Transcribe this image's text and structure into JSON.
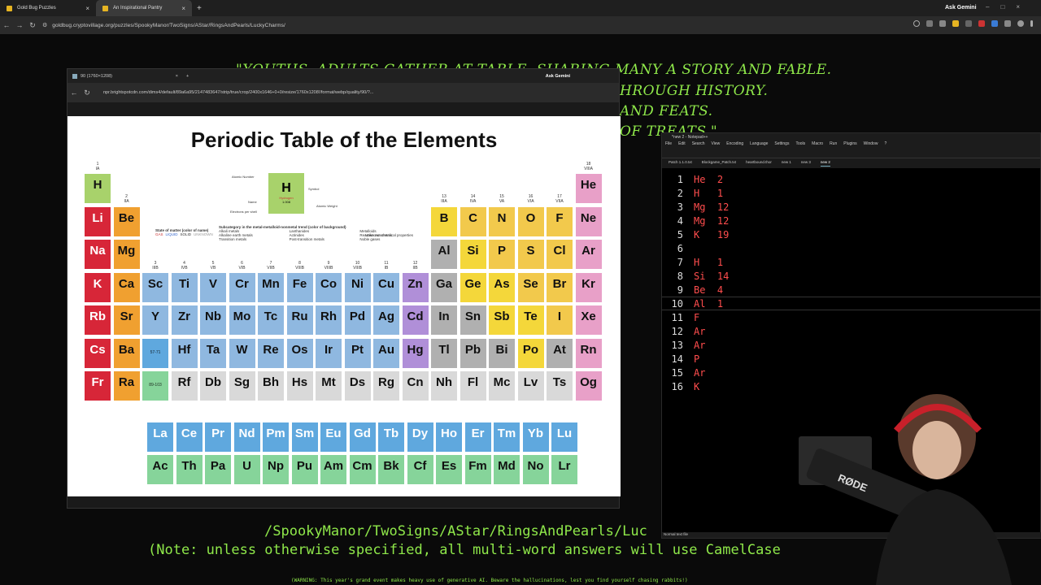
{
  "browser": {
    "tabs": [
      {
        "label": "Gold Bug Puzzles"
      },
      {
        "label": "An Inspirational Pantry"
      }
    ],
    "ask_gemini": "Ask Gemini",
    "url": "goldbug.cryptovillage.org/puzzles/SpookyManor/TwoSigns/AStar/RingsAndPearls/LuckyCharms/"
  },
  "poem": {
    "l1": "\"YOUTHS, ADULTS GATHER AT TABLE, SHARING MANY A STORY AND FABLE.",
    "l2": "HROUGH HISTORY.",
    "l3": "AND FEATS.",
    "l4": "OF TREATS.\""
  },
  "inner_browser": {
    "tab": "90 (1760×1208)",
    "ask_gemini": "Ask Gemini",
    "url": "npr.brightspotcdn.com/dims4/default/89a6a95/2147483647/strip/true/crop/2400x1646+0+0/resize/1760x1208!/format/webp/quality/90/?..."
  },
  "periodic": {
    "title": "Periodic Table of the Elements",
    "key": {
      "symbol": "H",
      "name": "Hydrogen",
      "weight": "1.008",
      "atomic_number": "1",
      "lbl_atomic_number": "Atomic Number",
      "lbl_symbol": "Symbol",
      "lbl_name": "Name",
      "lbl_weight": "Atomic Weight",
      "lbl_electrons": "Electrons per shell"
    },
    "legend": {
      "state": "State of matter (color of name)",
      "gas": "GAS",
      "liquid": "LIQUID",
      "solid": "SOLID",
      "unknown": "UNKNOWN",
      "subcategory": "Subcategory in the metal-metalloid-nonmetal trend (color of background)",
      "alkali": "Alkali metals",
      "alkaline": "Alkaline earth metals",
      "transition": "Transition metals",
      "lanthanides": "Lanthanides",
      "actinides": "Actinides",
      "posttransition": "Post-transition metals",
      "metalloids": "Metalloids",
      "reactive": "Reactive nonmetals",
      "noble": "Noble gases",
      "unknown_props": "Unknown chemical properties"
    },
    "groups": [
      "1",
      "2",
      "3",
      "4",
      "5",
      "6",
      "7",
      "8",
      "9",
      "10",
      "11",
      "12",
      "13",
      "14",
      "15",
      "16",
      "17",
      "18"
    ],
    "roman": [
      "IA",
      "IIA",
      "IIIB",
      "IVB",
      "VB",
      "VIB",
      "VIIB",
      "VIIIB",
      "VIIIB",
      "VIIIB",
      "IB",
      "IIB",
      "IIIA",
      "IVA",
      "VA",
      "VIA",
      "VIIA",
      "VIIIA"
    ],
    "lanthanide_placeholder": "57-71",
    "actinide_placeholder": "89-103",
    "colors": {
      "alkali": "#d72638",
      "alkaline": "#f4a52d",
      "transition": "#8fb8e0",
      "lanthanide": "#5fa8de",
      "actinide": "#86d49a",
      "post": "#b0b0b0",
      "metalloid": "#f4d73a",
      "nonmetal": "#f2c94c",
      "noble": "#e8a0c8",
      "hydrogen": "#a8d26b",
      "unknown": "#d9d9d9",
      "g12": "#b08fd8",
      "orange": "#f0a030"
    }
  },
  "notepad": {
    "title": "*new 2 - Notepad++",
    "menu": [
      "File",
      "Edit",
      "Search",
      "View",
      "Encoding",
      "Language",
      "Settings",
      "Tools",
      "Macro",
      "Run",
      "Plugins",
      "Window",
      "?"
    ],
    "tabs": [
      "Patch 1.1.0.txt",
      "Blockgame_Patch.txt",
      "heartbound.thor",
      "new 1",
      "new 3",
      "new 2"
    ],
    "lines": [
      "He  2",
      "H   1",
      "Mg  12",
      "Mg  12",
      "K   19",
      "",
      "H   1",
      "Si  14",
      "Be  4",
      "Al  1",
      "F",
      "Ar",
      "Ar",
      "P",
      "Ar",
      "K"
    ],
    "status": "Normal text file"
  },
  "subtitles": {
    "line1": "/SpookyManor/TwoSigns/AStar/RingsAndPearls/Luc",
    "line2": "(Note: unless otherwise specified, all multi-word answers will use CamelCase",
    "warning": "(WARNING: This year's grand event makes heavy use of generative AI. Beware the hallucinations, lest you find yourself chasing rabbits!)"
  },
  "streamer": {
    "mic_brand": "RØDE"
  }
}
